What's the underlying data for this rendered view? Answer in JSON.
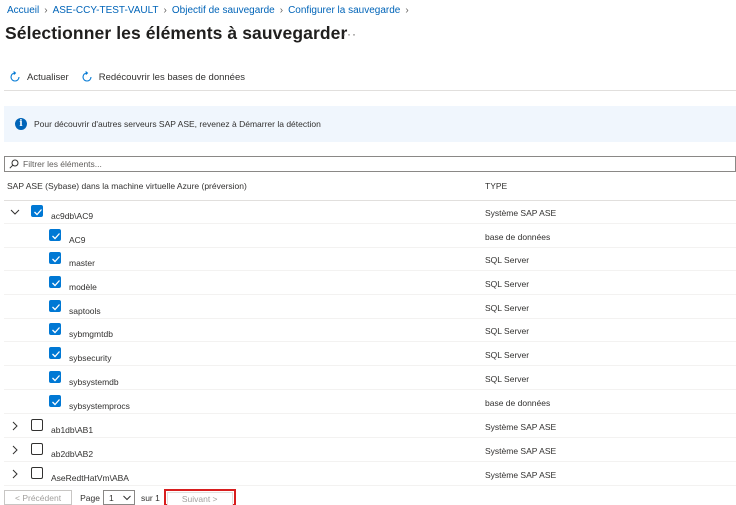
{
  "breadcrumb": [
    {
      "label": "Accueil"
    },
    {
      "label": "ASE-CCY-TEST-VAULT"
    },
    {
      "label": "Objectif de sauvegarde"
    },
    {
      "label": "Configurer la sauvegarde"
    }
  ],
  "page": {
    "title": "Sélectionner les éléments à sauvegarder",
    "more": "···"
  },
  "toolbar": {
    "refresh_label": "Actualiser",
    "rediscover_label": "Redécouvrir les bases de données"
  },
  "info": {
    "message": "Pour découvrir d'autres serveurs SAP ASE, revenez à Démarrer la détection"
  },
  "filter": {
    "placeholder": "Filtrer les éléments..."
  },
  "grid": {
    "col_name": "SAP ASE (Sybase) dans la machine virtuelle Azure (préversion)",
    "col_type": "TYPE",
    "rows": [
      {
        "name": "ac9db\\AC9",
        "type": "Système SAP ASE",
        "level": 0,
        "expanded": true,
        "checked": true
      },
      {
        "name": "AC9",
        "type": "base de données",
        "level": 1,
        "checked": true
      },
      {
        "name": "master",
        "type": "SQL Server",
        "level": 1,
        "checked": true
      },
      {
        "name": "modèle",
        "type": "SQL Server",
        "level": 1,
        "checked": true
      },
      {
        "name": "saptools",
        "type": "SQL Server",
        "level": 1,
        "checked": true
      },
      {
        "name": "sybmgmtdb",
        "type": "SQL Server",
        "level": 1,
        "checked": true
      },
      {
        "name": "sybsecurity",
        "type": "SQL Server",
        "level": 1,
        "checked": true
      },
      {
        "name": "sybsystemdb",
        "type": "SQL Server",
        "level": 1,
        "checked": true
      },
      {
        "name": "sybsystemprocs",
        "type": "base de données",
        "level": 1,
        "checked": true
      },
      {
        "name": "ab1db\\AB1",
        "type": "Système SAP ASE",
        "level": 0,
        "expanded": false,
        "checked": false
      },
      {
        "name": "ab2db\\AB2",
        "type": "Système SAP ASE",
        "level": 0,
        "expanded": false,
        "checked": false
      },
      {
        "name": "AseRedtHatVm\\ABA",
        "type": "Système SAP ASE",
        "level": 0,
        "expanded": false,
        "checked": false
      }
    ]
  },
  "pager": {
    "prev_label": "< Précédent",
    "page_label": "Page",
    "page_value": "1",
    "of_label": "sur 1",
    "next_label": "Suivant >"
  },
  "colors": {
    "accent": "#0078d4",
    "link": "#0064b8",
    "highlight": "#d81e1e",
    "info_bg": "#f0f6fd"
  }
}
